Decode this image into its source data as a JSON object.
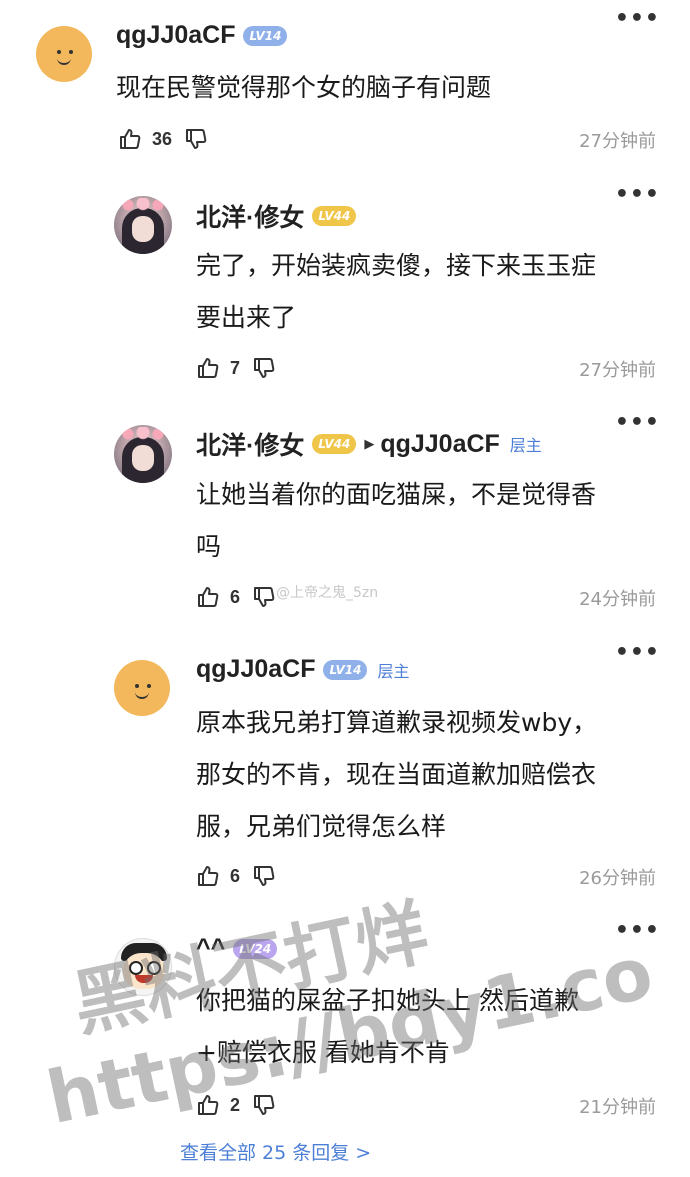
{
  "comments": [
    {
      "username": "qgJJ0aCF",
      "level": "LV14",
      "text_lines": [
        "现在民警觉得那个女的脑子有问题"
      ],
      "likes": "36",
      "time": "27分钟前"
    },
    {
      "username": "北洋·修女",
      "level": "LV44",
      "text_lines": [
        "完了，开始装疯卖傻，接下来玉玉症",
        "要出来了"
      ],
      "likes": "7",
      "time": "27分钟前"
    },
    {
      "username": "北洋·修女",
      "level": "LV44",
      "reply_to": "qgJJ0aCF",
      "reply_to_badge": "层主",
      "text_lines": [
        "让她当着你的面吃猫屎，不是觉得香",
        "吗"
      ],
      "likes": "6",
      "time": "24分钟前"
    },
    {
      "username": "qgJJ0aCF",
      "level": "LV14",
      "badge": "层主",
      "text_lines": [
        "原本我兄弟打算道歉录视频发wby，",
        "那女的不肯，现在当面道歉加赔偿衣",
        "服，兄弟们觉得怎么样"
      ],
      "likes": "6",
      "time": "26分钟前"
    },
    {
      "username": "^^",
      "level": "LV24",
      "text_lines": [
        "你把猫的屎盆子扣她头上 然后道歉",
        "+赔偿衣服 看她肯不肯"
      ],
      "likes": "2",
      "time": "21分钟前"
    }
  ],
  "more_icon": "•••",
  "view_all": "查看全部 25 条回复 >",
  "inline_watermark": "@上帝之鬼_5zn",
  "watermark": {
    "line1": "黑料不打烊",
    "line2": "https://bdy1.co"
  },
  "colors": {
    "link": "#4d7fd6",
    "time": "#9a9a9a",
    "level_blue": "#8fb0e8",
    "level_gold": "#f0c64a",
    "level_purple": "#b9a6ee"
  }
}
